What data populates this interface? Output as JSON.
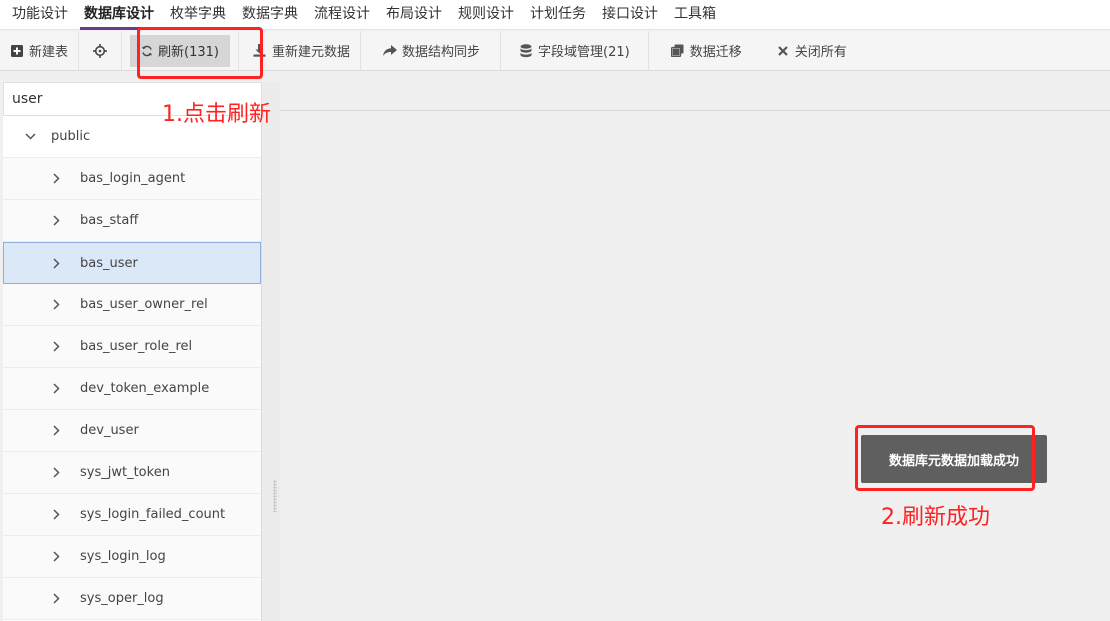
{
  "topmenu": {
    "items": [
      {
        "label": "功能设计",
        "active": false
      },
      {
        "label": "数据库设计",
        "active": true
      },
      {
        "label": "枚举字典",
        "active": false
      },
      {
        "label": "数据字典",
        "active": false
      },
      {
        "label": "流程设计",
        "active": false
      },
      {
        "label": "布局设计",
        "active": false
      },
      {
        "label": "规则设计",
        "active": false
      },
      {
        "label": "计划任务",
        "active": false
      },
      {
        "label": "接口设计",
        "active": false
      },
      {
        "label": "工具箱",
        "active": false
      }
    ]
  },
  "toolbar": {
    "new_table": "新建表",
    "refresh": "刷新(131)",
    "rebuild_meta": "重新建元数据",
    "sync_structure": "数据结构同步",
    "field_domain": "字段域管理(21)",
    "migrate": "数据迁移",
    "close_all": "关闭所有"
  },
  "sidebar": {
    "search_value": "user",
    "schema": "public",
    "tables": [
      {
        "name": "bas_login_agent",
        "selected": false
      },
      {
        "name": "bas_staff",
        "selected": false
      },
      {
        "name": "bas_user",
        "selected": true
      },
      {
        "name": "bas_user_owner_rel",
        "selected": false
      },
      {
        "name": "bas_user_role_rel",
        "selected": false
      },
      {
        "name": "dev_token_example",
        "selected": false
      },
      {
        "name": "dev_user",
        "selected": false
      },
      {
        "name": "sys_jwt_token",
        "selected": false
      },
      {
        "name": "sys_login_failed_count",
        "selected": false
      },
      {
        "name": "sys_login_log",
        "selected": false
      },
      {
        "name": "sys_oper_log",
        "selected": false
      }
    ]
  },
  "toast": {
    "message": "数据库元数据加载成功"
  },
  "annotations": {
    "step1": "1.点击刷新",
    "step2": "2.刷新成功"
  },
  "colors": {
    "accent": "#6b3e8d",
    "annotation": "#ff2222",
    "selected_row": "#dbe8f8",
    "toast_bg": "#5f5f5f"
  }
}
